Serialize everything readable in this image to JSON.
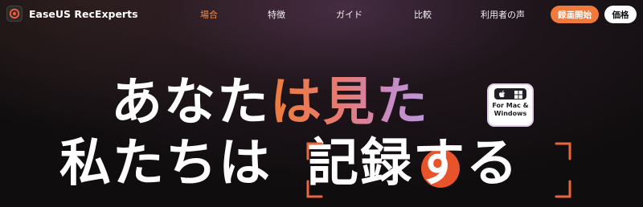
{
  "brand": {
    "name": "EaseUS RecExperts"
  },
  "nav": {
    "links": [
      "場合",
      "特徴",
      "ガイド",
      "比較",
      "利用者の声"
    ],
    "active_index": 0,
    "record_button": "録画開始",
    "price_button": "価格"
  },
  "hero": {
    "line1_white": "あなた",
    "line1_accent": "は見た",
    "line2_white_a": "私たちは",
    "line2_white_b": "記録する"
  },
  "badge": {
    "text_line1": "For Mac &",
    "text_line2": "Windows",
    "icons": [
      "apple-icon",
      "windows-icon"
    ]
  },
  "colors": {
    "accent_orange": "#f07a3c",
    "gradient_start": "#ee7c3a",
    "gradient_end": "#b99ad8",
    "record_dot": "#e8532a",
    "bracket": "#e8673a"
  }
}
